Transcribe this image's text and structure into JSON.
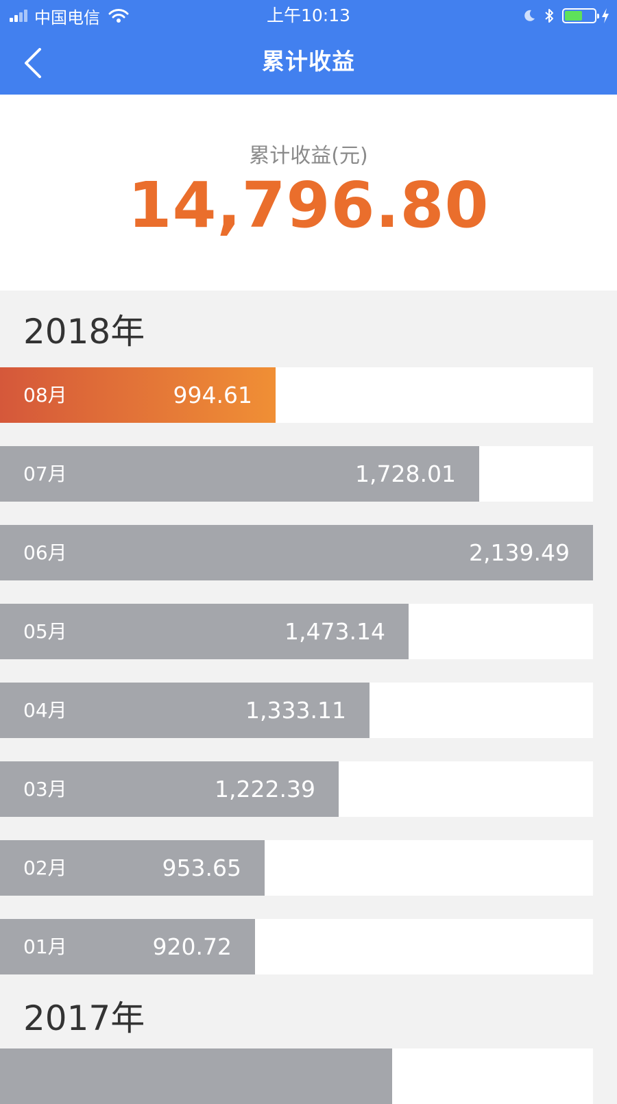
{
  "status_bar": {
    "carrier": "中国电信",
    "time": "上午10:13",
    "battery_level": 0.6
  },
  "nav": {
    "title": "累计收益",
    "back_icon": "chevron-left-icon"
  },
  "summary": {
    "label": "累计收益(元)",
    "value": "14,796.80"
  },
  "colors": {
    "header_bg": "#4280ef",
    "accent_orange": "#ea6e2c",
    "bar_gray": "#a4a6ab",
    "current_gradient": [
      "#d5583a",
      "#f08f35"
    ],
    "page_bg": "#f2f2f2"
  },
  "years": [
    {
      "year": "2018年",
      "months": [
        {
          "label": "08月",
          "value": "994.61",
          "amount": 994.61,
          "current": true
        },
        {
          "label": "07月",
          "value": "1,728.01",
          "amount": 1728.01
        },
        {
          "label": "06月",
          "value": "2,139.49",
          "amount": 2139.49
        },
        {
          "label": "05月",
          "value": "1,473.14",
          "amount": 1473.14
        },
        {
          "label": "04月",
          "value": "1,333.11",
          "amount": 1333.11
        },
        {
          "label": "03月",
          "value": "1,222.39",
          "amount": 1222.39
        },
        {
          "label": "02月",
          "value": "953.65",
          "amount": 953.65
        },
        {
          "label": "01月",
          "value": "920.72",
          "amount": 920.72
        }
      ]
    },
    {
      "year": "2017年",
      "months": []
    }
  ]
}
